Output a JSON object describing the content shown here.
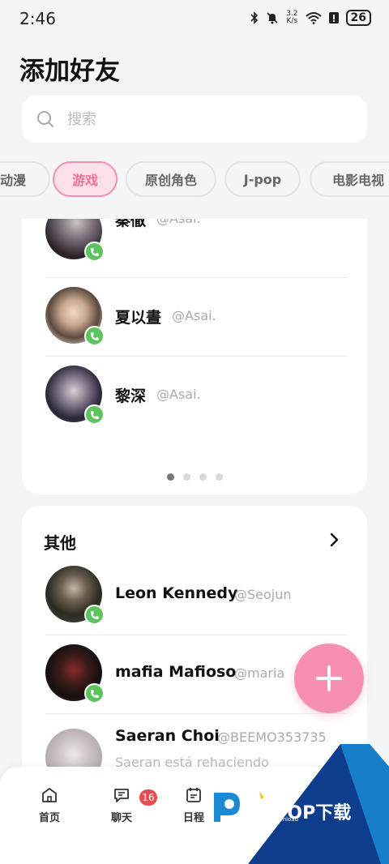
{
  "status_bar": {
    "time": "2:46",
    "net_speed_value": "3.2",
    "net_speed_unit": "K/s",
    "battery": "26"
  },
  "page_title": "添加好友",
  "search": {
    "placeholder": "搜索"
  },
  "tabs": [
    {
      "label": "动漫",
      "active": false
    },
    {
      "label": "游戏",
      "active": true
    },
    {
      "label": "原创角色",
      "active": false
    },
    {
      "label": "J-pop",
      "active": false
    },
    {
      "label": "电影电视",
      "active": false
    }
  ],
  "featured_contacts": [
    {
      "name": "秦徹",
      "handle": "@Asai."
    },
    {
      "name": "夏以晝",
      "handle": "@Asai."
    },
    {
      "name": "黎深",
      "handle": "@Asai."
    }
  ],
  "pagination": {
    "pages": 4,
    "current": 1
  },
  "other_section": {
    "title": "其他",
    "contacts": [
      {
        "name": "Leon Kennedy",
        "handle": "@Seojun"
      },
      {
        "name": "mafia Mafioso",
        "handle": "@maria"
      },
      {
        "name": "Saeran Choi",
        "handle": "@BEEMO353735",
        "subtitle": "Saeran está rehaciendo"
      }
    ]
  },
  "bottom_nav": [
    {
      "label": "首页",
      "icon": "home-icon"
    },
    {
      "label": "聊天",
      "icon": "chat-icon",
      "badge": "16"
    },
    {
      "label": "日程",
      "icon": "calendar-icon"
    }
  ],
  "watermark": {
    "brand": "PCPOP下载",
    "sub": "PCPOP Download"
  },
  "colors": {
    "accent_pink": "#f78fb0",
    "tab_active_bg": "#fde0ea",
    "call_green": "#5cc45c",
    "badge_red": "#e74c52",
    "watermark_blue": "#0d3d8c"
  }
}
